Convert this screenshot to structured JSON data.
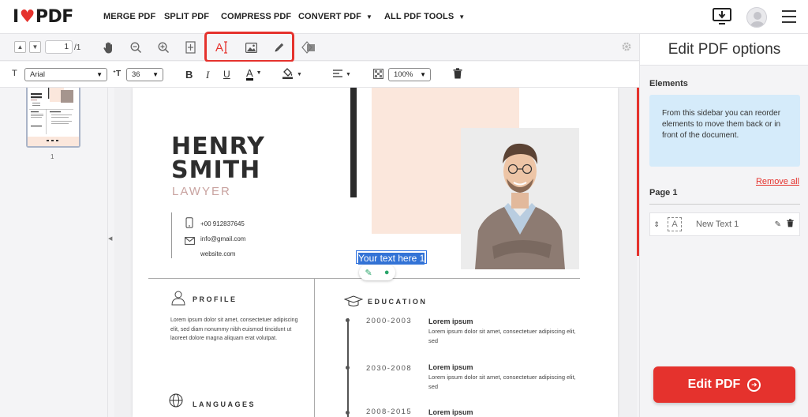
{
  "brand": {
    "logo_left": "I",
    "logo_right": "PDF"
  },
  "nav": {
    "items": [
      {
        "label": "MERGE PDF",
        "dropdown": false
      },
      {
        "label": "SPLIT PDF",
        "dropdown": false
      },
      {
        "label": "COMPRESS PDF",
        "dropdown": false
      },
      {
        "label": "CONVERT PDF",
        "dropdown": true
      },
      {
        "label": "ALL PDF TOOLS",
        "dropdown": true
      }
    ]
  },
  "toolbar": {
    "page_current": "1",
    "page_total": "/1",
    "tools": [
      "hand-icon",
      "zoom-out-icon",
      "zoom-in-icon",
      "fit-page-icon",
      "add-text-icon",
      "add-image-icon",
      "draw-icon",
      "shapes-icon",
      "settings-icon"
    ]
  },
  "format_bar": {
    "font_family": "Arial",
    "font_size": "36",
    "bold": "B",
    "italic": "I",
    "underline": "U",
    "text_color_label": "A",
    "opacity": "100%"
  },
  "thumbnail": {
    "page_number": "1"
  },
  "resume": {
    "first_name": "HENRY",
    "last_name": "SMITH",
    "role": "LAWYER",
    "phone": "+00 912837645",
    "email": "info@gmail.com",
    "website": "website.com",
    "profile_title": "PROFILE",
    "profile_text": "Lorem ipsum dolor sit amet, consectetuer adipiscing elit, sed diam nonummy nibh euismod tincidunt ut laoreet dolore magna aliquam erat volutpat.",
    "languages_title": "LANGUAGES",
    "education_title": "EDUCATION",
    "education": [
      {
        "years": "2000-2003",
        "head": "Lorem ipsum",
        "desc": "Lorem ipsum dolor sit amet, consectetuer adipiscing elit, sed"
      },
      {
        "years": "2030-2008",
        "head": "Lorem ipsum",
        "desc": "Lorem ipsum dolor sit amet, consectetuer adipiscing elit, sed"
      },
      {
        "years": "2008-2015",
        "head": "Lorem ipsum",
        "desc": ""
      }
    ]
  },
  "inserted_text": "Your text here 1",
  "sidebar": {
    "title": "Edit PDF options",
    "elements_label": "Elements",
    "info": "From this sidebar you can reorder elements to move them back or in front of the document.",
    "remove_all": "Remove all",
    "page_label": "Page 1",
    "element_item": "New Text 1",
    "edit_button": "Edit PDF"
  },
  "colors": {
    "brand_red": "#e5322d",
    "peach": "#fbe7dc",
    "info_blue": "#d5ebfa",
    "selection_blue": "#3373d6"
  }
}
